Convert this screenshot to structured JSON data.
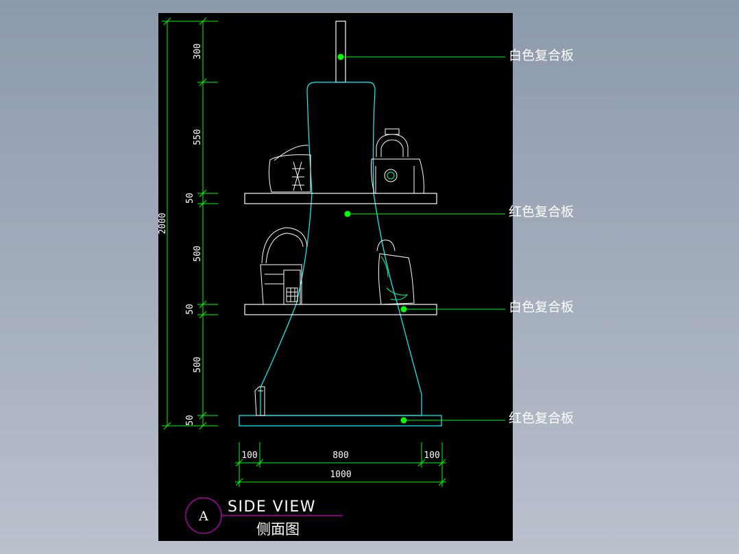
{
  "callouts": [
    {
      "id": "c1",
      "text": "白色复合板"
    },
    {
      "id": "c2",
      "text": "红色复合板"
    },
    {
      "id": "c3",
      "text": "白色复合板"
    },
    {
      "id": "c4",
      "text": "红色复合板"
    }
  ],
  "dimensions": {
    "vertical": [
      "300",
      "550",
      "50",
      "500",
      "50",
      "500",
      "50"
    ],
    "total_height": "2000",
    "horizontal": [
      "100",
      "800",
      "100"
    ],
    "total_width": "1000"
  },
  "title": {
    "marker": "A",
    "english": "SIDE VIEW",
    "chinese": "侧面图"
  },
  "colors": {
    "background": "#000000",
    "outline": "#00ffff",
    "dimension": "#00ff00",
    "leader": "#00ff00",
    "bubble": "#cc00cc",
    "text": "#ffffff"
  }
}
